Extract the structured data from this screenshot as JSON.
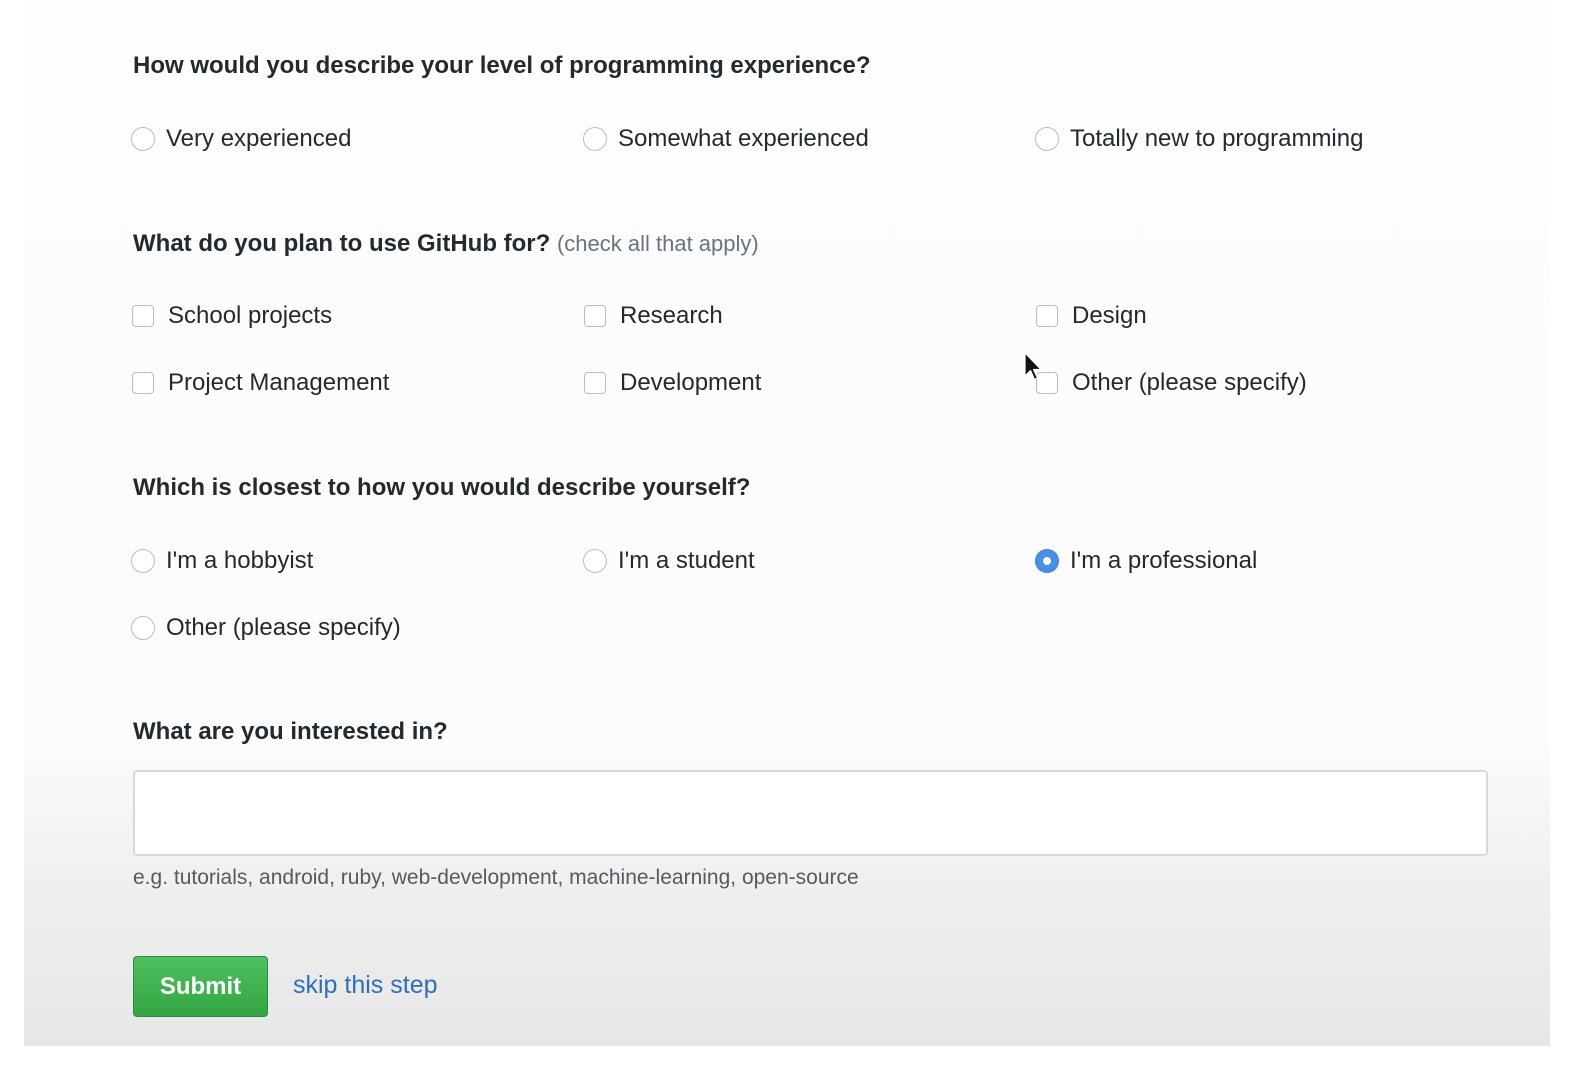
{
  "q1": {
    "title": "How would you describe your level of programming experience?",
    "options": [
      "Very experienced",
      "Somewhat experienced",
      "Totally new to programming"
    ]
  },
  "q2": {
    "title": "What do you plan to use GitHub for?",
    "note": "(check all that apply)",
    "options": [
      "School projects",
      "Research",
      "Design",
      "Project Management",
      "Development",
      "Other (please specify)"
    ]
  },
  "q3": {
    "title": "Which is closest to how you would describe yourself?",
    "options": [
      "I'm a hobbyist",
      "I'm a student",
      "I'm a professional",
      "Other (please specify)"
    ],
    "selected": "I'm a professional"
  },
  "q4": {
    "title": "What are you interested in?",
    "value": "",
    "hint": "e.g. tutorials, android, ruby, web-development, machine-learning, open-source"
  },
  "actions": {
    "submit_label": "Submit",
    "skip_label": "skip this step"
  },
  "colors": {
    "selected_radio": "#4a8fe6",
    "submit_button": "#3aae4a",
    "link": "#2f6fb5"
  },
  "icons": {
    "pointer": "mouse-pointer-icon"
  }
}
